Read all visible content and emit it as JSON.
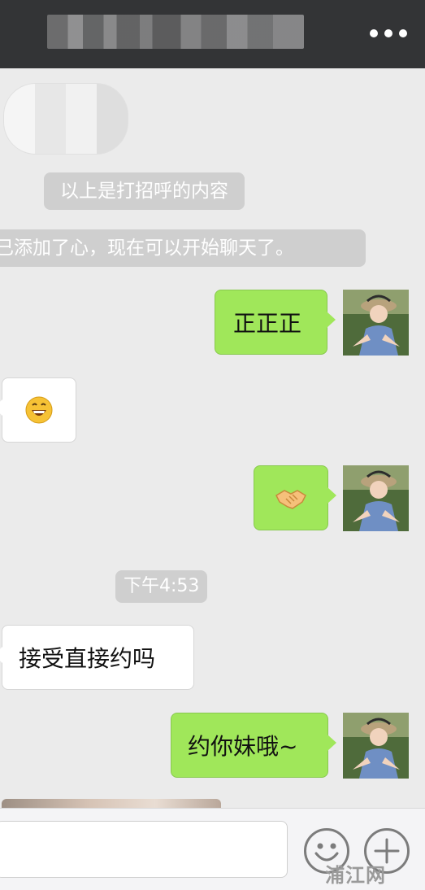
{
  "header": {
    "title": "",
    "more_icon": "more-dots-icon"
  },
  "messages": {
    "system_greeting": "以上是打招呼的内容",
    "system_added": "已添加了心，现在可以开始聊天了。",
    "out_1": "正正正",
    "in_1_emoji": "grinning-face",
    "out_2_emoji": "handshake",
    "time": "下午4:53",
    "in_2": "接受直接约吗",
    "out_3": "约你妹哦~"
  },
  "input": {
    "placeholder": "",
    "emoji_icon": "smiley-face-icon",
    "plus_icon": "plus-icon"
  },
  "watermark": "浦江网",
  "colors": {
    "header_bg": "#333436",
    "chat_bg": "#ebebeb",
    "outgoing_bubble": "#a0e75a",
    "incoming_bubble": "#ffffff",
    "system_pill": "#cfcfcf"
  }
}
